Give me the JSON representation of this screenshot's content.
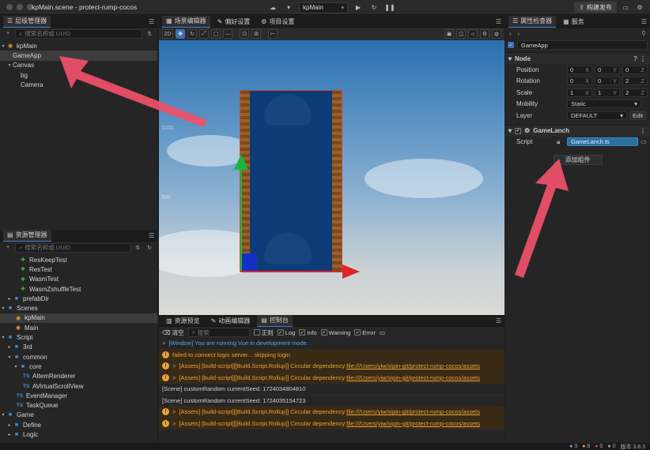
{
  "window": {
    "title": "kpMain.scene - protect-rump-cocos",
    "scene_select": "kpMain",
    "publish": "构建发布"
  },
  "hierarchy": {
    "title": "层级管理器",
    "search_placeholder": "搜索名称或 UUID",
    "nodes": [
      "kpMain",
      "GameApp",
      "Canvas",
      "bg",
      "Camera"
    ]
  },
  "assets": {
    "title": "资源管理器",
    "search_placeholder": "搜索名称或 UUID",
    "items": [
      "ResKeepTest",
      "ResTest",
      "WasmTest",
      "WasmZshuffleTest",
      "prefabDir",
      "Scenes",
      "kpMain",
      "Main",
      "Script",
      "3rd",
      "common",
      "core",
      "AItemRenderer",
      "AVirtualScrollView",
      "EventManager",
      "TaskQueue",
      "Game",
      "Define",
      "Logic"
    ]
  },
  "scene": {
    "tabs": [
      "场景编辑器",
      "偏好设置",
      "项目设置"
    ],
    "mode_2d": "2D",
    "grid_labels": [
      "1000",
      "500"
    ]
  },
  "console": {
    "tabs": [
      "资源预览",
      "动画编辑器",
      "控制台"
    ],
    "clear": "清空",
    "search_placeholder": "搜索",
    "regex": "正则",
    "filters": [
      "Log",
      "Info",
      "Warning",
      "Error"
    ],
    "logs": [
      {
        "type": "info",
        "text": "[Window] You are running Vue in development mode."
      },
      {
        "type": "warn",
        "text": "failed to connect login server... skipping login"
      },
      {
        "type": "warn",
        "text": "[Assets] [build-script][[Build.Script.Rollup]] Circular dependency: ",
        "link": "file:///Users/yiw/xipin-git/protect-rump-cocos/assets"
      },
      {
        "type": "warn",
        "text": "[Assets] [build-script][[Build.Script.Rollup]] Circular dependency: ",
        "link": "file:///Users/yiw/xipin-git/protect-rump-cocos/assets"
      },
      {
        "type": "log",
        "text": "[Scene] customRandom currentSeed: 1724034804810"
      },
      {
        "type": "log",
        "text": "[Scene] customRandom currentSeed: 1724035154723"
      },
      {
        "type": "warn",
        "text": "[Assets] [build-script][[Build.Script.Rollup]] Circular dependency: ",
        "link": "file:///Users/yiw/xipin-git/protect-rump-cocos/assets"
      },
      {
        "type": "warn",
        "text": "[Assets] [build-script][[Build.Script.Rollup]] Circular dependency: ",
        "link": "file:///Users/yiw/xipin-git/protect-rump-cocos/assets"
      }
    ]
  },
  "inspector": {
    "tabs": [
      "属性检查器",
      "服务"
    ],
    "node_name": "GameApp",
    "node_section": "Node",
    "position": {
      "label": "Position",
      "x": "0",
      "y": "0",
      "z": "0"
    },
    "rotation": {
      "label": "Rotation",
      "x": "0",
      "y": "0",
      "z": "2"
    },
    "scale": {
      "label": "Scale",
      "x": "1",
      "y": "1",
      "z": "2"
    },
    "axis": {
      "x": "X",
      "y": "Y",
      "z": "Z"
    },
    "mobility": {
      "label": "Mobility",
      "value": "Static"
    },
    "layer": {
      "label": "Layer",
      "value": "DEFAULT",
      "edit": "Edit"
    },
    "component": {
      "name": "GameLanch",
      "script_label": "Script",
      "script_value": "GameLanch.ts"
    },
    "add_component": "添加组件"
  },
  "status": {
    "a": "3",
    "b": "8",
    "c": "0",
    "d": "0",
    "version": "版本 3.8.3"
  }
}
